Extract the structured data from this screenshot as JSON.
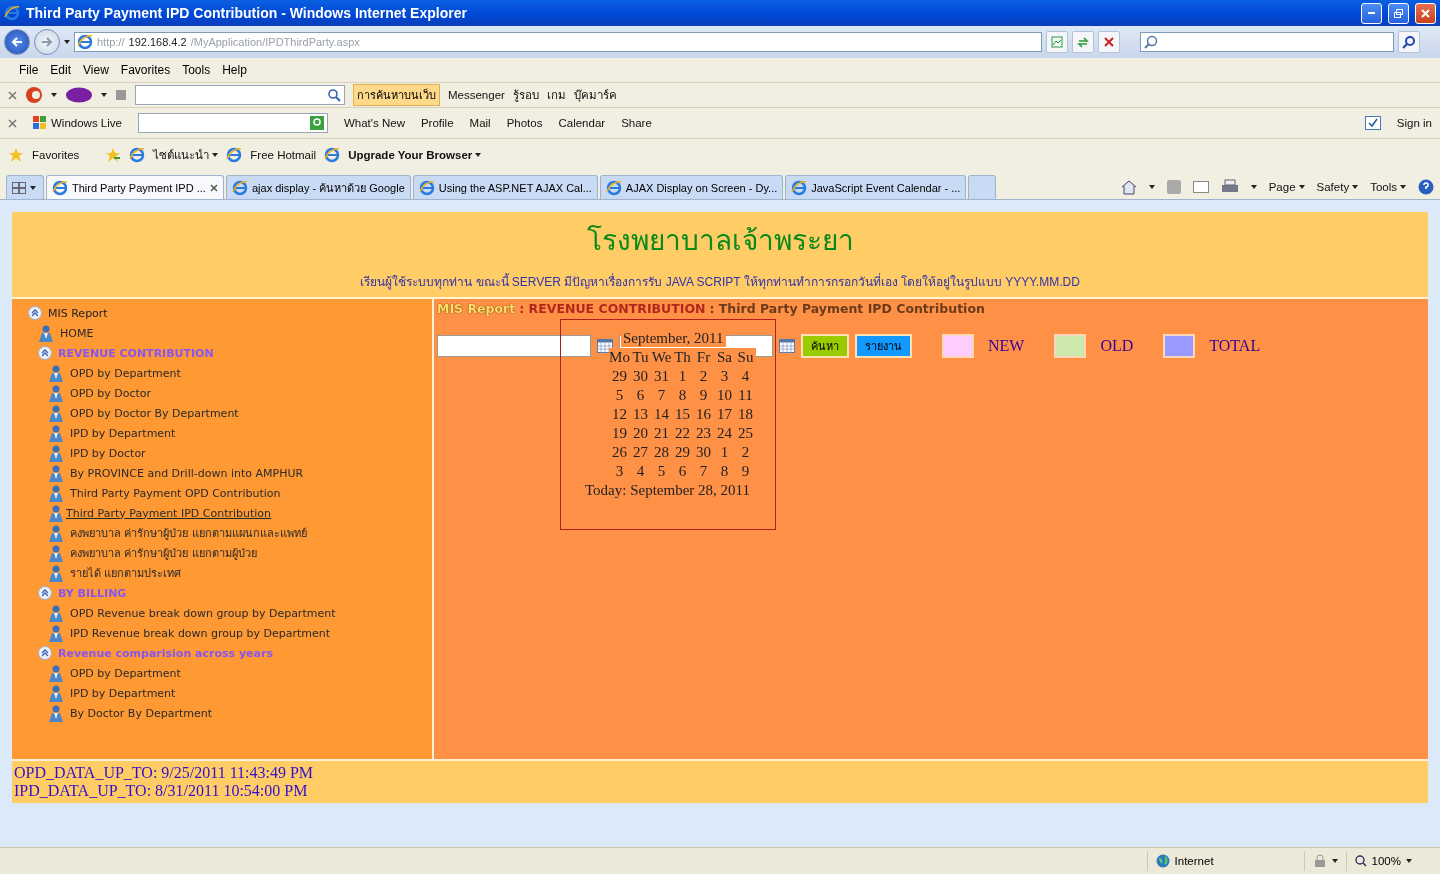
{
  "window": {
    "title": "Third Party Payment IPD Contribution - Windows Internet Explorer"
  },
  "address_bar": {
    "url_parts": [
      {
        "text": "http://",
        "emphasis": false
      },
      {
        "text": "192.168.4.2",
        "emphasis": true
      },
      {
        "text": "/MyApplication/IPDThirdParty.aspx",
        "emphasis": false
      }
    ]
  },
  "menu_bar": [
    "File",
    "Edit",
    "View",
    "Favorites",
    "Tools",
    "Help"
  ],
  "yahoo_toolbar": {
    "search_button": "การค้นหาบนเว็บ",
    "items": [
      "Messenger",
      "รู้รอบ",
      "เกม",
      "บุ๊คมาร์ค"
    ]
  },
  "live_toolbar": {
    "brand": "Windows Live",
    "links": [
      "What's New",
      "Profile",
      "Mail",
      "Photos",
      "Calendar",
      "Share"
    ],
    "sign_in": "Sign in"
  },
  "favorites_bar": {
    "label": "Favorites",
    "items": [
      {
        "text": "ไซต์แนะนำ",
        "bold": false,
        "menu": true
      },
      {
        "text": "Free Hotmail",
        "bold": false,
        "menu": false
      },
      {
        "text": "Upgrade Your Browser",
        "bold": true,
        "menu": true
      }
    ]
  },
  "tabs": [
    {
      "label": "Third Party Payment IPD ...",
      "selected": true
    },
    {
      "label": "ajax display - ค้นหาด้วย Google",
      "selected": false
    },
    {
      "label": "Using the ASP.NET AJAX Cal...",
      "selected": false
    },
    {
      "label": "AJAX Display on Screen - Dy...",
      "selected": false
    },
    {
      "label": "JavaScript Event Calendar - ...",
      "selected": false
    }
  ],
  "command_bar": [
    "Page",
    "Safety",
    "Tools"
  ],
  "page": {
    "hospital_name": "โรงพยาบาลเจ้าพระยา",
    "notice": "เรียนผู้ใช้ระบบทุกท่าน ขณะนี้ SERVER มีปัญหาเรื่องการรับ JAVA SCRIPT ให้ทุกท่านทำการกรอกวันที่เอง โดยให้อยู่ในรูปแบบ YYYY.MM.DD",
    "sidebar": [
      {
        "label": "MIS Report",
        "kind": "section",
        "expanded": true,
        "children": [
          {
            "label": "HOME",
            "kind": "link",
            "selected": false
          },
          {
            "label": "REVENUE CONTRIBUTION",
            "kind": "section",
            "expanded": true,
            "children": [
              {
                "label": "OPD by Department",
                "kind": "link",
                "selected": false
              },
              {
                "label": "OPD by Doctor",
                "kind": "link",
                "selected": false
              },
              {
                "label": "OPD by Doctor By Department",
                "kind": "link",
                "selected": false
              },
              {
                "label": "IPD by Department",
                "kind": "link",
                "selected": false
              },
              {
                "label": "IPD by Doctor",
                "kind": "link",
                "selected": false
              },
              {
                "label": "By PROVINCE and Drill-down into AMPHUR",
                "kind": "link",
                "selected": false
              },
              {
                "label": "Third Party Payment OPD Contribution",
                "kind": "link",
                "selected": false
              },
              {
                "label": "Third Party Payment IPD Contribution",
                "kind": "link",
                "selected": true
              },
              {
                "label": "คงพยาบาล ค่ารักษาผู้ป่วย แยกตามแผนกและแพทย์",
                "kind": "link",
                "selected": false
              },
              {
                "label": "คงพยาบาล ค่ารักษาผู้ป่วย แยกตามผู้ป่วย",
                "kind": "link",
                "selected": false
              },
              {
                "label": "รายได้ แยกตามประเทศ",
                "kind": "link",
                "selected": false
              }
            ]
          },
          {
            "label": "BY BILLING",
            "kind": "section",
            "expanded": true,
            "children": [
              {
                "label": "OPD Revenue break down group by Department",
                "kind": "link",
                "selected": false
              },
              {
                "label": "IPD Revenue break down group by Department",
                "kind": "link",
                "selected": false
              }
            ]
          },
          {
            "label": "Revenue comparision across years",
            "kind": "section",
            "expanded": true,
            "children": [
              {
                "label": "OPD by Department",
                "kind": "link",
                "selected": false
              },
              {
                "label": "IPD by Department",
                "kind": "link",
                "selected": false
              },
              {
                "label": "By Doctor By Department",
                "kind": "link",
                "selected": false
              }
            ]
          }
        ]
      }
    ],
    "breadcrumb": [
      {
        "text": "MIS Report",
        "color": "#ffe066"
      },
      {
        "text": ": REVENUE CONTRIBUTION",
        "color": "#b3261e"
      },
      {
        "text": ": Third Party Payment IPD Contribution",
        "color": "#6b3b1a"
      }
    ],
    "buttons": [
      {
        "label": "ค้นหา",
        "color": "#99cc00"
      },
      {
        "label": "รายงาน",
        "color": "#1199ff"
      }
    ],
    "legend": [
      {
        "label": "NEW",
        "color": "#ffccff"
      },
      {
        "label": "OLD",
        "color": "#cce8aa"
      },
      {
        "label": "TOTAL",
        "color": "#9999ff"
      }
    ],
    "calendar": {
      "title": "September, 2011",
      "weekdays": [
        "Mo",
        "Tu",
        "We",
        "Th",
        "Fr",
        "Sa",
        "Su"
      ],
      "weeks": [
        [
          "29",
          "30",
          "31",
          "1",
          "2",
          "3",
          "4"
        ],
        [
          "5",
          "6",
          "7",
          "8",
          "9",
          "10",
          "11"
        ],
        [
          "12",
          "13",
          "14",
          "15",
          "16",
          "17",
          "18"
        ],
        [
          "19",
          "20",
          "21",
          "22",
          "23",
          "24",
          "25"
        ],
        [
          "26",
          "27",
          "28",
          "29",
          "30",
          "1",
          "2"
        ],
        [
          "3",
          "4",
          "5",
          "6",
          "7",
          "8",
          "9"
        ]
      ],
      "today": "Today: September 28, 2011"
    },
    "footer": [
      "OPD_DATA_UP_TO: 9/25/2011 11:43:49 PM",
      "IPD_DATA_UP_TO: 8/31/2011 10:54:00 PM"
    ]
  },
  "status_bar": {
    "zone": "Internet",
    "zoom": "100%"
  }
}
